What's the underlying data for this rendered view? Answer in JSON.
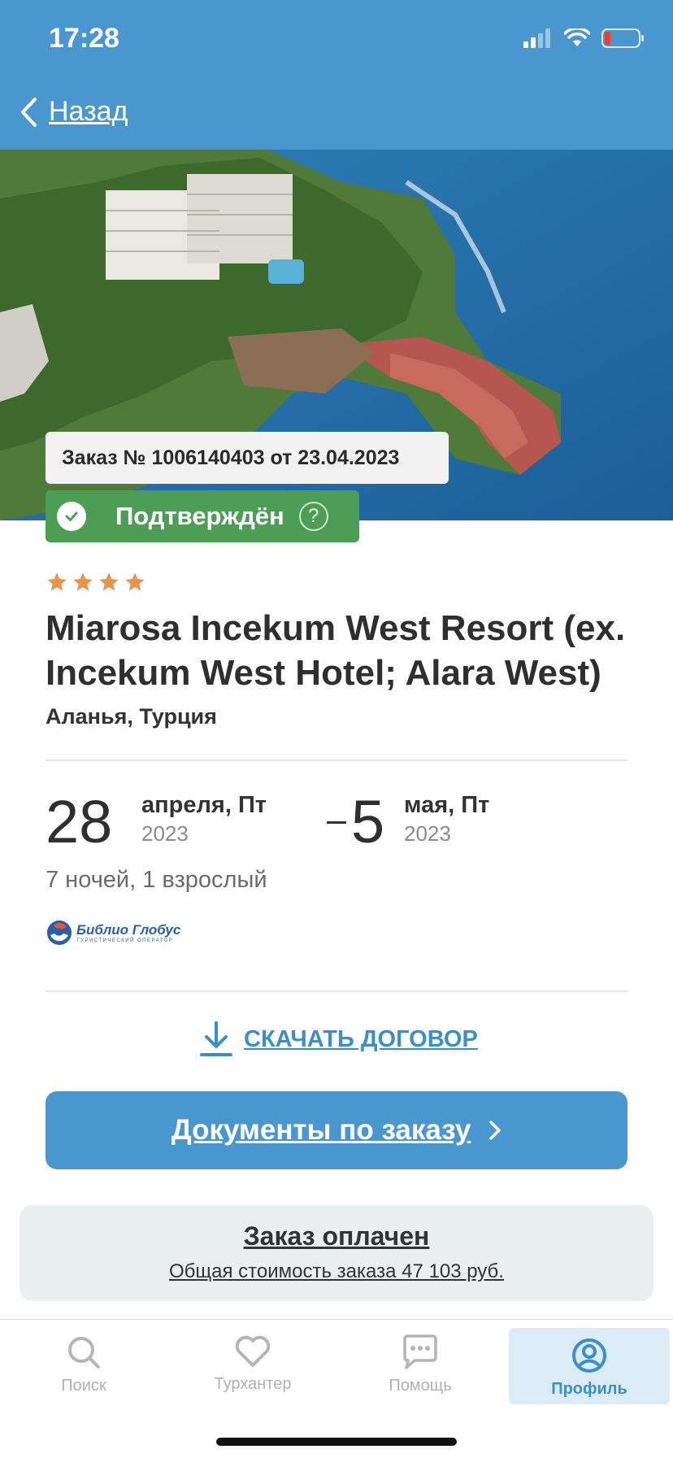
{
  "status_bar": {
    "time": "17:28"
  },
  "header": {
    "back_label": "Назад"
  },
  "order": {
    "number_line": "Заказ № 1006140403 от 23.04.2023",
    "status": "Подтверждён",
    "help": "?"
  },
  "hotel": {
    "stars": 4,
    "name": "Miarosa Incekum West Resort (ex. Incekum West Hotel; Alara West)",
    "location": "Аланья, Турция"
  },
  "dates": {
    "start_day": "28",
    "start_month": "апреля, Пт",
    "start_year": "2023",
    "end_day": "5",
    "end_month": "мая, Пт",
    "end_year": "2023"
  },
  "trip": {
    "summary": "7 ночей, 1 взрослый"
  },
  "operator": {
    "name": "Библио Глобус",
    "subtitle": "ТУРИСТИЧЕСКИЙ ОПЕРАТОР"
  },
  "actions": {
    "download_label": "СКАЧАТЬ ДОГОВОР",
    "documents_label": "Документы по заказу"
  },
  "payment": {
    "title": "Заказ оплачен",
    "total": "Общая стоимость заказа 47 103 руб."
  },
  "tabbar": {
    "items": [
      {
        "label": "Поиск",
        "icon": "search-icon"
      },
      {
        "label": "Турхантер",
        "icon": "heart-icon"
      },
      {
        "label": "Помощь",
        "icon": "chat-icon"
      },
      {
        "label": "Профиль",
        "icon": "profile-icon"
      }
    ],
    "active": "Профиль"
  },
  "colors": {
    "header": "#4a96cf",
    "confirmed": "#4c9e55",
    "star": "#e8944a",
    "link": "#3a8fcb"
  }
}
